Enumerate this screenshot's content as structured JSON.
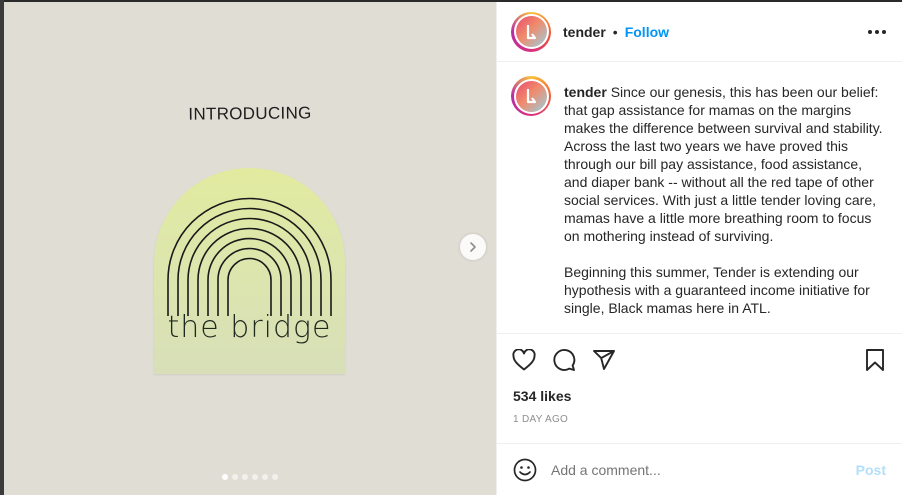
{
  "post": {
    "media": {
      "intro_text": "INTRODUCING",
      "logo_text": "the bridge",
      "carousel_count": 6,
      "carousel_active": 0
    },
    "header": {
      "username": "tender",
      "separator": "•",
      "follow_label": "Follow"
    },
    "caption": {
      "username": "tender",
      "paragraph1": "Since our genesis, this has been our belief: that gap assistance for mamas on the margins makes the difference between survival and stability. Across the last two years we have proved this through our bill pay assistance, food assistance, and diaper bank -- without all the red tape of other social services. With just a little tender loving care, mamas have a little more breathing room to focus on mothering instead of surviving.",
      "paragraph2": "Beginning this summer, Tender is extending our hypothesis with a guaranteed income initiative for single, Black mamas here in ATL."
    },
    "likes": "534 likes",
    "timestamp": "1 DAY AGO",
    "comment": {
      "placeholder": "Add a comment...",
      "post_label": "Post"
    },
    "icons": {
      "like": "heart-icon",
      "comment": "comment-icon",
      "share": "send-icon",
      "save": "bookmark-icon",
      "emoji": "smiley-icon",
      "more": "more-icon",
      "next": "chevron-right-icon"
    },
    "colors": {
      "follow": "#0095f6",
      "post_disabled": "#b2dffc",
      "media_bg": "#e0ddd5"
    }
  }
}
